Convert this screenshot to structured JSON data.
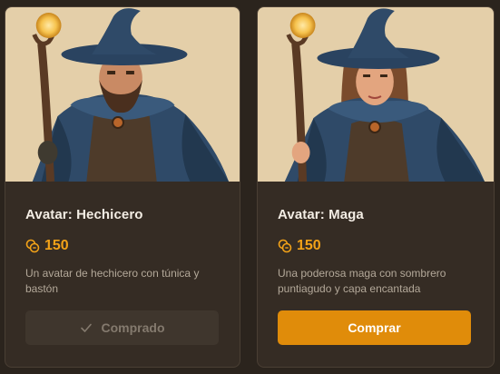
{
  "cards": [
    {
      "title": "Avatar: Hechicero",
      "price": "150",
      "description": "Un avatar de hechicero con túnica y bastón",
      "button_label": "Comprado",
      "button_state": "purchased",
      "coin_icon": "coins-icon",
      "button_icon": "check-icon",
      "image": "wizard-avatar-illustration"
    },
    {
      "title": "Avatar: Maga",
      "price": "150",
      "description": "Una poderosa maga con sombrero puntiagudo y capa encantada",
      "button_label": "Comprar",
      "button_state": "available",
      "coin_icon": "coins-icon",
      "image": "witch-avatar-illustration"
    }
  ],
  "colors": {
    "background": "#2b241d",
    "card": "#352c24",
    "price": "#f2a218",
    "buy_button": "#e08c0a",
    "purchased_button": "#3f362d"
  }
}
